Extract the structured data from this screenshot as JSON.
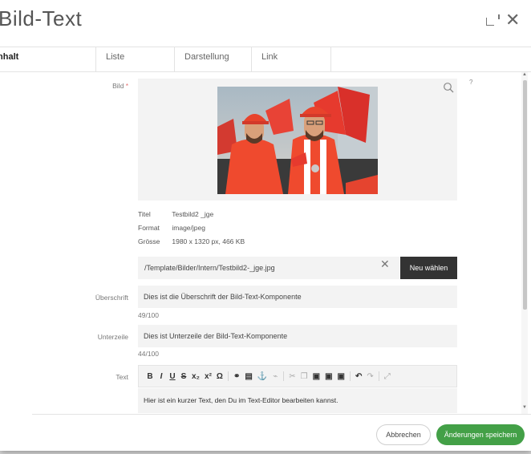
{
  "dialog": {
    "title": "Bild-Text",
    "close_glyph": "✕",
    "tabs": [
      {
        "label": "Inhalt",
        "active": true
      },
      {
        "label": "Liste",
        "active": false
      },
      {
        "label": "Darstellung",
        "active": false
      },
      {
        "label": "Link",
        "active": false
      }
    ]
  },
  "image_field": {
    "label": "Bild",
    "required_marker": "*",
    "help": "?",
    "search_icon": "magnifier-icon",
    "meta": {
      "title_key": "Titel",
      "title_val": "Testbild2 _jge",
      "format_key": "Format",
      "format_val": "image/jpeg",
      "size_key": "Grösse",
      "size_val": "1980 x 1320 px, 466 KB"
    },
    "path": "/Template/Bilder/Intern/Testbild2-_jge.jpg",
    "clear_glyph": "✕",
    "choose_label": "Neu wählen"
  },
  "heading_field": {
    "label": "Überschrift",
    "value": "Dies ist die Überschrift der Bild-Text-Komponente",
    "counter": "49/100"
  },
  "subline_field": {
    "label": "Unterzeile",
    "value": "Dies ist Unterzeile der Bild-Text-Komponente",
    "counter": "44/100"
  },
  "text_field": {
    "label": "Text",
    "toolbar": [
      "B",
      "I",
      "U",
      "S",
      "x₂",
      "x²",
      "Ω",
      "link-icon",
      "image-icon",
      "anchor-icon",
      "unlink-icon",
      "cut-icon",
      "copy-icon",
      "paste-icon",
      "paste-text-icon",
      "paste-word-icon",
      "undo-icon",
      "redo-icon",
      "maximize-icon"
    ],
    "value": "Hier ist ein kurzer Text, den Du im Text-Editor bearbeiten kannst."
  },
  "footer": {
    "cancel_label": "Abbrechen",
    "save_label": "Änderungen speichern"
  },
  "colors": {
    "save_button": "#43a047",
    "dark_button": "#333333",
    "required": "#e57373",
    "banner_red": "#e63a2e"
  }
}
